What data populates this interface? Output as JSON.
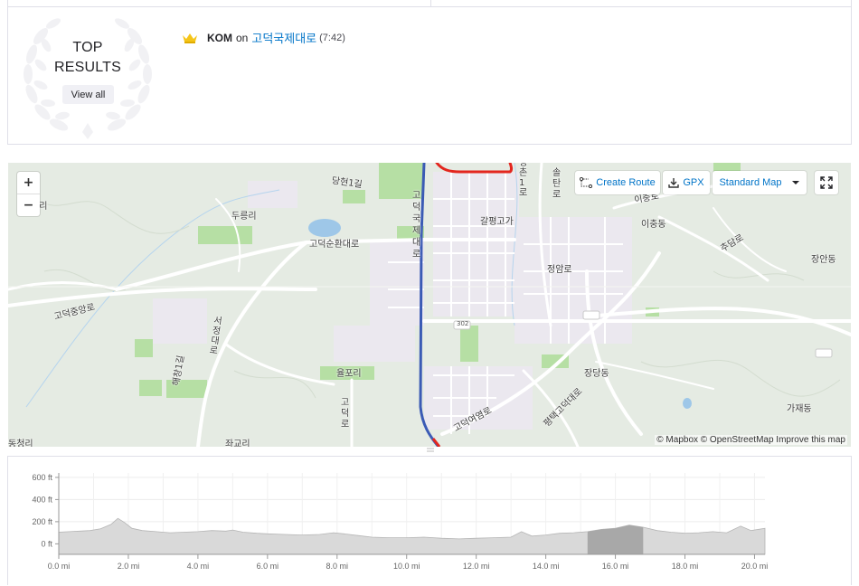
{
  "results": {
    "title_line1": "TOP",
    "title_line2": "RESULTS",
    "view_all": "View all",
    "kom_label": "KOM",
    "kom_on": "on",
    "segment_name": "고덕국제대로",
    "segment_time": "(7:42)"
  },
  "map": {
    "zoom_in": "+",
    "zoom_out": "−",
    "create_route": "Create Route",
    "gpx": "GPX",
    "map_style": "Standard Map",
    "attribution": "© Mapbox © OpenStreetMap Improve this map",
    "labels": [
      {
        "text": "곡리",
        "name": "label-gokri"
      },
      {
        "text": "두릉리",
        "name": "label-dureungri"
      },
      {
        "text": "당현1길",
        "name": "label-danghyeon"
      },
      {
        "text": "고덕국제대로",
        "name": "label-godeokgukje"
      },
      {
        "text": "고덕순환대로",
        "name": "label-godeoksunhwan"
      },
      {
        "text": "갈평고가",
        "name": "label-galpyeong"
      },
      {
        "text": "청촌1로",
        "name": "label-cheongchon"
      },
      {
        "text": "솔탄로",
        "name": "label-soltan"
      },
      {
        "text": "이충로",
        "name": "label-ichungro"
      },
      {
        "text": "이충동",
        "name": "label-ichungdong"
      },
      {
        "text": "추담로",
        "name": "label-chudam"
      },
      {
        "text": "장안동",
        "name": "label-jangan"
      },
      {
        "text": "정암로",
        "name": "label-jeongam"
      },
      {
        "text": "고덕중앙로",
        "name": "label-godeokjungang"
      },
      {
        "text": "율포리",
        "name": "label-yulpori"
      },
      {
        "text": "고덕로",
        "name": "label-godeokro"
      },
      {
        "text": "장당동",
        "name": "label-jangdang"
      },
      {
        "text": "가재동",
        "name": "label-gajae"
      },
      {
        "text": "고덕여염로",
        "name": "label-yeoyeom"
      },
      {
        "text": "서정대로",
        "name": "label-seojeong"
      },
      {
        "text": "동청리",
        "name": "label-dongcheong"
      },
      {
        "text": "좌교리",
        "name": "label-jwagyo"
      },
      {
        "text": "평택고덕대로",
        "name": "label-pyeongtaek"
      },
      {
        "text": "해창1길",
        "name": "label-haechang"
      },
      {
        "text": "302",
        "name": "label-route-302"
      }
    ]
  },
  "elevation": {
    "y_ticks": [
      "600 ft",
      "400 ft",
      "200 ft",
      "0 ft"
    ],
    "y_values": [
      600,
      400,
      200,
      0
    ],
    "x_ticks": [
      "0.0 mi",
      "2.0 mi",
      "4.0 mi",
      "6.0 mi",
      "8.0 mi",
      "10.0 mi",
      "12.0 mi",
      "14.0 mi",
      "16.0 mi",
      "18.0 mi",
      "20.0 mi"
    ],
    "x_values": [
      0,
      2,
      4,
      6,
      8,
      10,
      12,
      14,
      16,
      18,
      20
    ],
    "x_max": 20.3,
    "y_min": -95,
    "y_max": 640,
    "highlight_range": [
      15.2,
      16.8
    ],
    "profile": [
      [
        0.0,
        105
      ],
      [
        0.3,
        110
      ],
      [
        0.6,
        115
      ],
      [
        0.9,
        120
      ],
      [
        1.2,
        135
      ],
      [
        1.5,
        175
      ],
      [
        1.7,
        230
      ],
      [
        1.9,
        190
      ],
      [
        2.1,
        140
      ],
      [
        2.4,
        120
      ],
      [
        2.8,
        110
      ],
      [
        3.2,
        100
      ],
      [
        3.6,
        105
      ],
      [
        4.0,
        110
      ],
      [
        4.4,
        120
      ],
      [
        4.8,
        115
      ],
      [
        5.0,
        125
      ],
      [
        5.3,
        105
      ],
      [
        5.7,
        95
      ],
      [
        6.0,
        90
      ],
      [
        6.5,
        85
      ],
      [
        7.0,
        80
      ],
      [
        7.5,
        85
      ],
      [
        7.9,
        100
      ],
      [
        8.2,
        90
      ],
      [
        8.6,
        75
      ],
      [
        9.0,
        60
      ],
      [
        9.5,
        55
      ],
      [
        10.0,
        55
      ],
      [
        10.5,
        60
      ],
      [
        11.0,
        50
      ],
      [
        11.5,
        45
      ],
      [
        12.0,
        50
      ],
      [
        12.5,
        55
      ],
      [
        13.0,
        60
      ],
      [
        13.3,
        110
      ],
      [
        13.6,
        70
      ],
      [
        14.0,
        80
      ],
      [
        14.4,
        95
      ],
      [
        14.8,
        100
      ],
      [
        15.2,
        110
      ],
      [
        15.6,
        130
      ],
      [
        16.0,
        140
      ],
      [
        16.4,
        170
      ],
      [
        16.8,
        150
      ],
      [
        17.2,
        120
      ],
      [
        17.6,
        105
      ],
      [
        18.0,
        95
      ],
      [
        18.4,
        100
      ],
      [
        18.8,
        110
      ],
      [
        19.2,
        100
      ],
      [
        19.6,
        160
      ],
      [
        19.9,
        120
      ],
      [
        20.3,
        140
      ]
    ]
  },
  "colors": {
    "route_blue": "#3b5bb5",
    "route_red": "#e3261e",
    "map_bg": "#e5ebe3",
    "map_green": "#b6dfa4",
    "link_blue": "#0074c8"
  }
}
